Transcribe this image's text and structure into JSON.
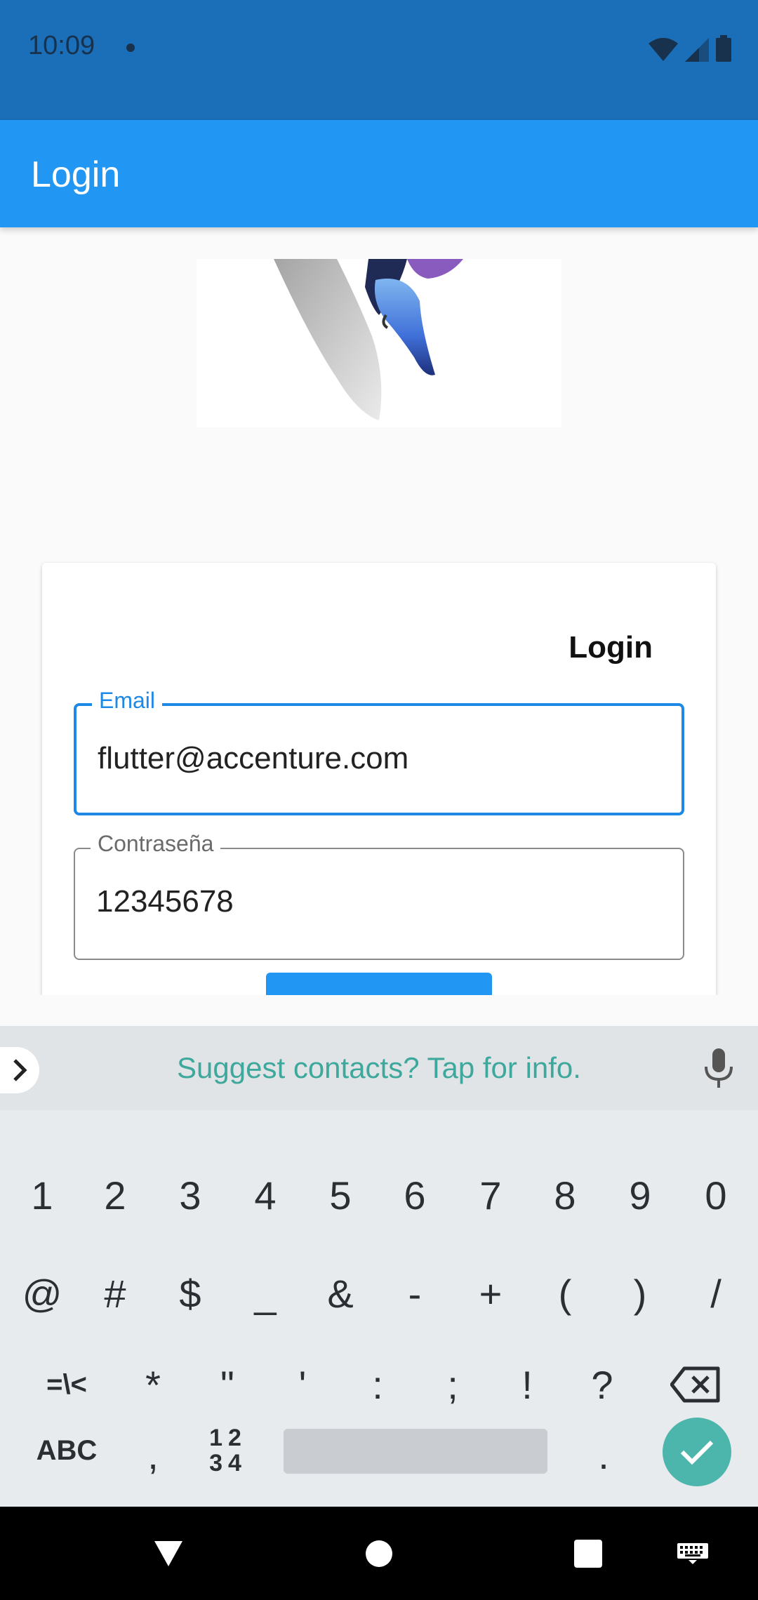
{
  "status_bar": {
    "time": "10:09"
  },
  "app_bar": {
    "title": "Login"
  },
  "card": {
    "title": "Login",
    "email": {
      "label": "Email",
      "value": "flutter@accenture.com"
    },
    "password": {
      "label": "Contraseña",
      "value": "12345678"
    }
  },
  "keyboard": {
    "suggestion": "Suggest contacts? Tap for info.",
    "row1": [
      "1",
      "2",
      "3",
      "4",
      "5",
      "6",
      "7",
      "8",
      "9",
      "0"
    ],
    "row2": [
      "@",
      "#",
      "$",
      "_",
      "&",
      "-",
      "+",
      "(",
      ")",
      "/"
    ],
    "row3": [
      "=\\<",
      "*",
      "\"",
      "'",
      ":",
      ";",
      "!",
      "?"
    ],
    "abc_label": "ABC",
    "comma": ",",
    "num_top": "12",
    "num_bottom": "34",
    "period": "."
  },
  "colors": {
    "status_bar": "#1a6fb8",
    "app_bar": "#2196f3",
    "accent": "#1e88e5",
    "enter": "#4db6ac"
  }
}
